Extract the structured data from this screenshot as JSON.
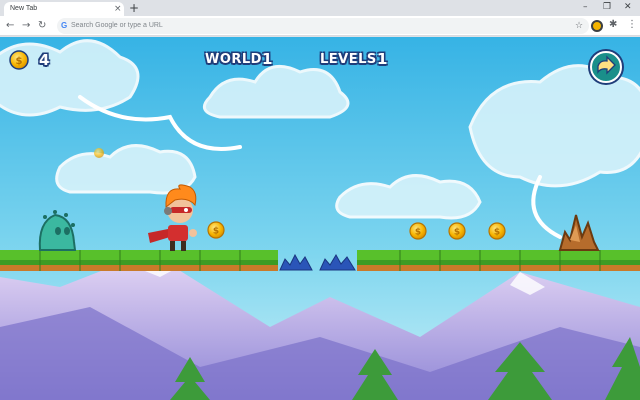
{
  "browser": {
    "tab_title": "New Tab",
    "tab_close": "×",
    "new_tab": "+",
    "window_minimize": "–",
    "window_restore": "❐",
    "window_close": "✕",
    "omnibox_placeholder": "Search Google or type a URL",
    "google_glyph": "G",
    "star": "☆",
    "puzzle": "✱",
    "kebab": "⋮",
    "back": "←",
    "forward": "→",
    "reload": "↻"
  },
  "hud": {
    "coin_count": "4",
    "world_label": "WORLD",
    "world_value": "1",
    "levels_label": "LEVELS",
    "levels_value": "1"
  },
  "icons": {
    "coin": "coin-icon",
    "next": "arrow-right-icon"
  },
  "colors": {
    "sky_top": "#38b6e6",
    "sky_bottom": "#9fe3f2",
    "grass": "#58c02b",
    "dirt": "#c97a2a",
    "coin": "#f7b500",
    "hud_outline": "#1f3d7a"
  }
}
